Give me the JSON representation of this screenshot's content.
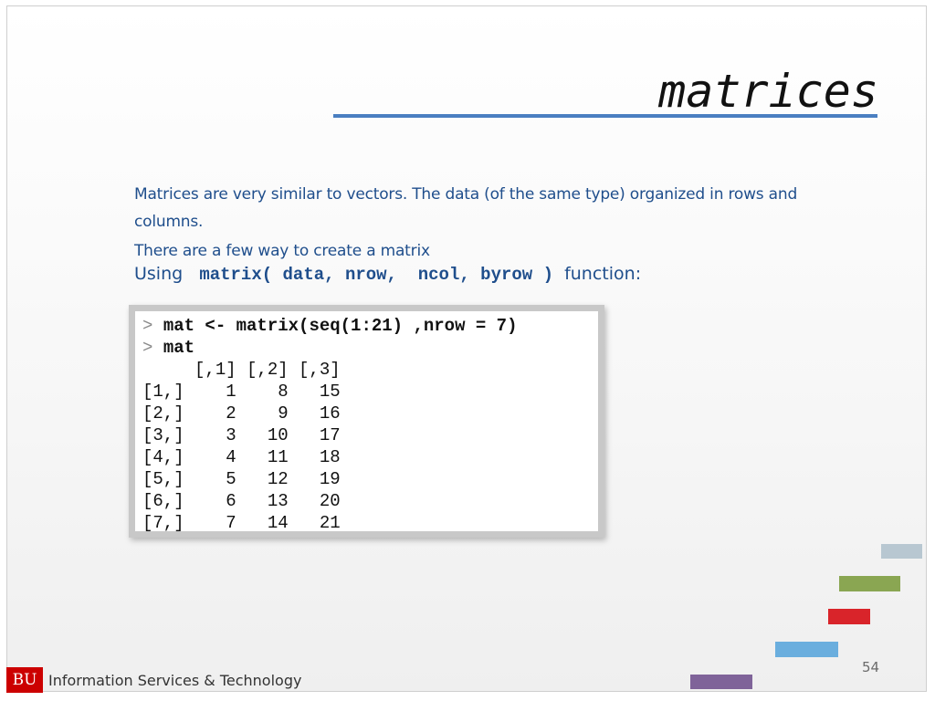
{
  "slide": {
    "title": "matrices",
    "page_number": "54"
  },
  "content": {
    "paragraph1": "Matrices are very similar to vectors. The data (of the same type) organized in rows and columns.",
    "paragraph2": "There are a few way to create a matrix",
    "using_prefix": "Using",
    "using_code": "matrix( data, nrow,  ncol, byrow )",
    "using_suffix": "function:"
  },
  "console": {
    "prompt": ">",
    "lines": [
      {
        "type": "command",
        "prompt": ">",
        "text": "mat <- matrix(seq(1:21) ,nrow = 7)"
      },
      {
        "type": "command",
        "prompt": ">",
        "text": "mat"
      },
      {
        "type": "output",
        "text": "     [,1] [,2] [,3]"
      },
      {
        "type": "output",
        "text": "[1,]    1    8   15"
      },
      {
        "type": "output",
        "text": "[2,]    2    9   16"
      },
      {
        "type": "output",
        "text": "[3,]    3   10   17"
      },
      {
        "type": "output",
        "text": "[4,]    4   11   18"
      },
      {
        "type": "output",
        "text": "[5,]    5   12   19"
      },
      {
        "type": "output",
        "text": "[6,]    6   13   20"
      },
      {
        "type": "output",
        "text": "[7,]    7   14   21"
      }
    ]
  },
  "footer": {
    "logo_text": "BU",
    "org_name": "Information Services & Technology"
  },
  "decoration": {
    "bars": [
      {
        "name": "decor-bar-gray-blue",
        "color": "#b8c7d1"
      },
      {
        "name": "decor-bar-green",
        "color": "#8aa652"
      },
      {
        "name": "decor-bar-red",
        "color": "#d9242a"
      },
      {
        "name": "decor-bar-light-blue",
        "color": "#6aaede"
      },
      {
        "name": "decor-bar-purple",
        "color": "#7f6399"
      }
    ]
  },
  "colors": {
    "accent_rule": "#4a7fc1",
    "body_text": "#1f4e8c",
    "logo_red": "#cc0000"
  }
}
